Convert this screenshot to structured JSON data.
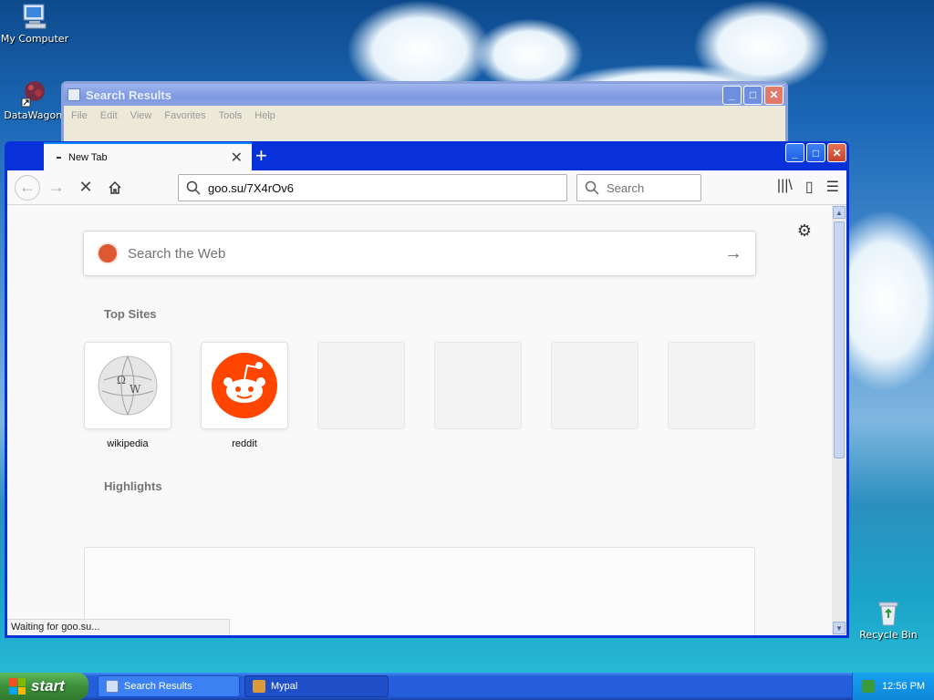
{
  "desktop": {
    "icons": [
      {
        "label": "My Computer"
      },
      {
        "label": "DataWagon."
      },
      {
        "label": "Recycle Bin"
      }
    ]
  },
  "background_window": {
    "title": "Search Results",
    "menu": [
      "File",
      "Edit",
      "View",
      "Favorites",
      "Tools",
      "Help"
    ]
  },
  "browser": {
    "tab_title": "New Tab",
    "url": "goo.su/7X4rOv6",
    "search_placeholder": "Search",
    "web_search_placeholder": "Search the Web",
    "top_sites_title": "Top Sites",
    "top_sites": [
      {
        "name": "wikipedia"
      },
      {
        "name": "reddit"
      }
    ],
    "highlights_title": "Highlights",
    "status": "Waiting for goo.su..."
  },
  "taskbar": {
    "start_label": "start",
    "items": [
      {
        "label": "Search Results"
      },
      {
        "label": "Mypal"
      }
    ],
    "clock": "12:56 PM"
  }
}
